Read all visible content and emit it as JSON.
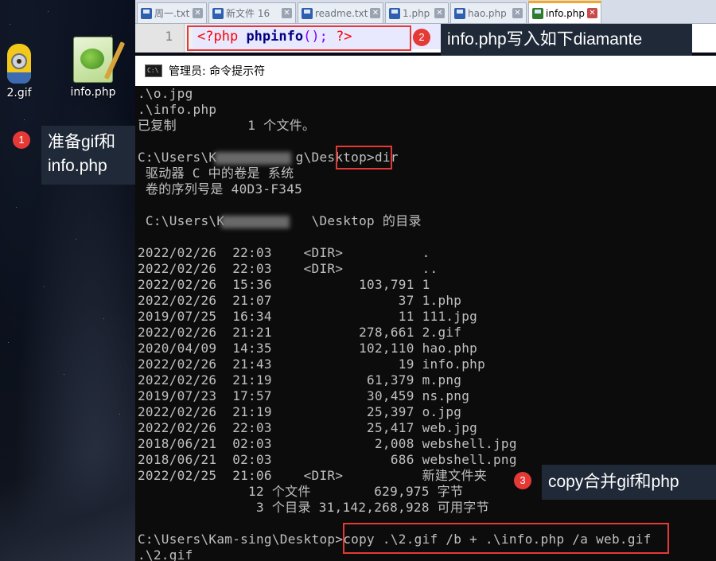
{
  "desktop": {
    "icons": [
      {
        "label": "2.gif",
        "icon": "minion-gif-icon"
      },
      {
        "label": "info.php",
        "icon": "notepadpp-file-icon"
      }
    ]
  },
  "tabs": [
    {
      "label": "周一.txt",
      "active": false
    },
    {
      "label": "新文件 16",
      "active": false
    },
    {
      "label": "readme.txt",
      "active": false
    },
    {
      "label": "1.php",
      "active": false
    },
    {
      "label": "hao.php",
      "active": false
    },
    {
      "label": "info.php",
      "active": true
    }
  ],
  "tab_close_glyph": "✕",
  "editor": {
    "line_number": "1",
    "code": {
      "open": "<?php",
      "func": "phpinfo",
      "sep": "();",
      "close": "?>"
    }
  },
  "notes": {
    "n1_badge": "1",
    "n1_text_a": "准备gif和",
    "n1_text_b": "info.php",
    "n2_badge": "2",
    "n2_text": "info.php写入如下diamante",
    "n3_badge": "3",
    "n3_text": "copy合并gif和php"
  },
  "cmd": {
    "title": "管理员: 命令提示符",
    "icon_text": "C:\\"
  },
  "terminal_lines": [
    ".\\o.jpg",
    ".\\info.php",
    "已复制         1 个文件。",
    "",
    "C:\\Users\\K          g\\Desktop>dir",
    " 驱动器 C 中的卷是 系统",
    " 卷的序列号是 40D3-F345",
    "",
    " C:\\Users\\K           \\Desktop 的目录",
    "",
    "2022/02/26  22:03    <DIR>          .",
    "2022/02/26  22:03    <DIR>          ..",
    "2022/02/26  15:36           103,791 1",
    "2022/02/26  21:07                37 1.php",
    "2019/07/25  16:34                11 111.jpg",
    "2022/02/26  21:21           278,661 2.gif",
    "2020/04/09  14:35           102,110 hao.php",
    "2022/02/26  21:43                19 info.php",
    "2022/02/26  21:19            61,379 m.png",
    "2019/07/23  17:57            30,459 ns.png",
    "2022/02/26  21:19            25,397 o.jpg",
    "2022/02/26  22:03            25,417 web.jpg",
    "2018/06/21  02:03             2,008 webshell.jpg",
    "2018/06/21  02:03               686 webshell.png",
    "2022/02/25  21:06    <DIR>          新建文件夹",
    "              12 个文件        629,975 字节",
    "               3 个目录 31,142,268,928 可用字节",
    "",
    "C:\\Users\\Kam-sing\\Desktop>copy .\\2.gif /b + .\\info.php /a web.gif",
    ".\\2.gif"
  ]
}
